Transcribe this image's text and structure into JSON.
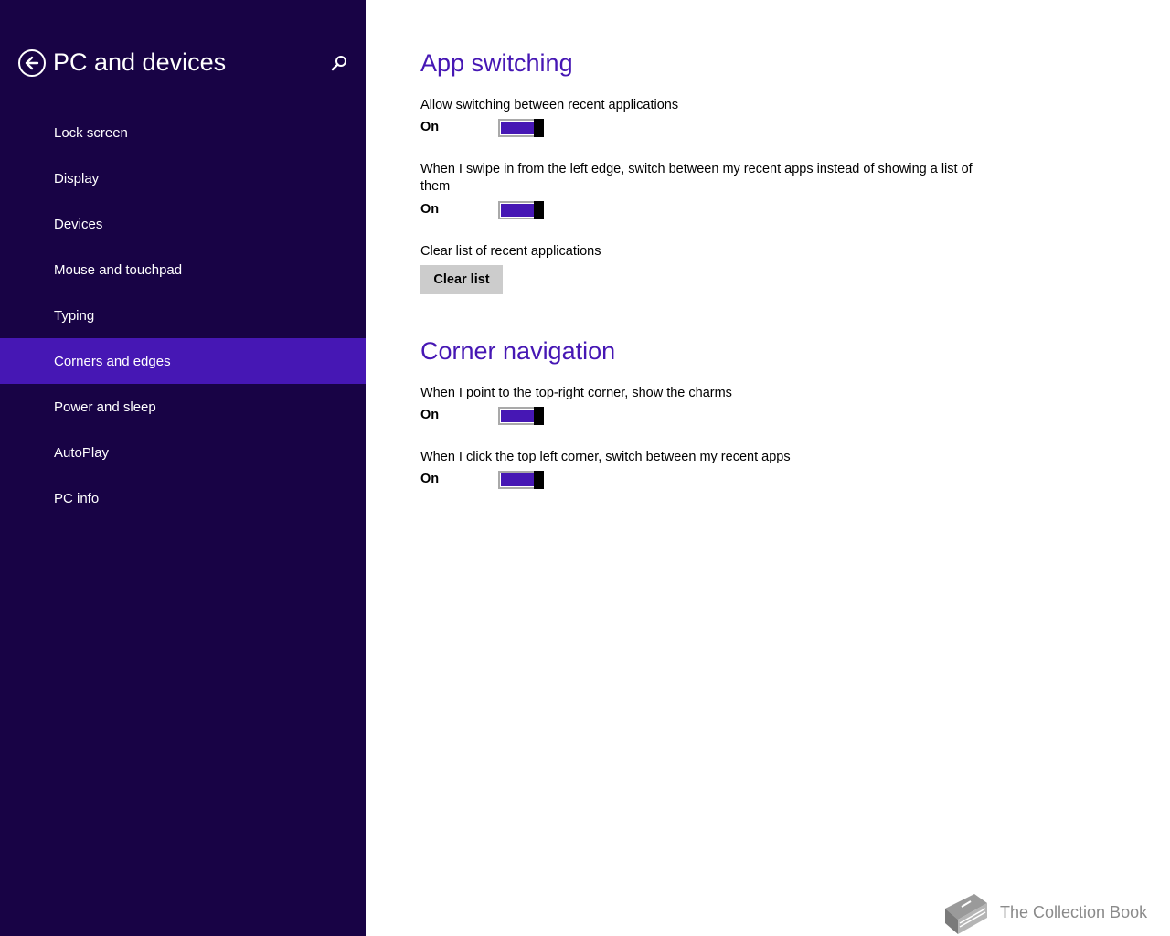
{
  "sidebar": {
    "back_icon": "back-arrow-icon",
    "title": "PC and devices",
    "search_icon": "search-icon",
    "selected_index": 5,
    "items": [
      {
        "label": "Lock screen"
      },
      {
        "label": "Display"
      },
      {
        "label": "Devices"
      },
      {
        "label": "Mouse and touchpad"
      },
      {
        "label": "Typing"
      },
      {
        "label": "Corners and edges"
      },
      {
        "label": "Power and sleep"
      },
      {
        "label": "AutoPlay"
      },
      {
        "label": "PC info"
      }
    ]
  },
  "main": {
    "app_switching": {
      "title": "App switching",
      "allow_switching": {
        "label": "Allow switching between recent applications",
        "state": "On"
      },
      "swipe_left": {
        "label": "When I swipe in from the left edge, switch between my recent apps instead of showing a list of them",
        "state": "On"
      },
      "clear_list": {
        "label": "Clear list of recent applications",
        "button": "Clear list"
      }
    },
    "corner_navigation": {
      "title": "Corner navigation",
      "top_right": {
        "label": "When I point to the top-right corner, show the charms",
        "state": "On"
      },
      "top_left": {
        "label": "When I click the top left corner, switch between my recent apps",
        "state": "On"
      }
    }
  },
  "watermark": {
    "text": "The Collection Book",
    "icon": "book-icon"
  },
  "colors": {
    "sidebar_bg": "#180345",
    "accent": "#4617b4",
    "toggle_thumb": "#000000",
    "button_bg": "#cccccc"
  }
}
